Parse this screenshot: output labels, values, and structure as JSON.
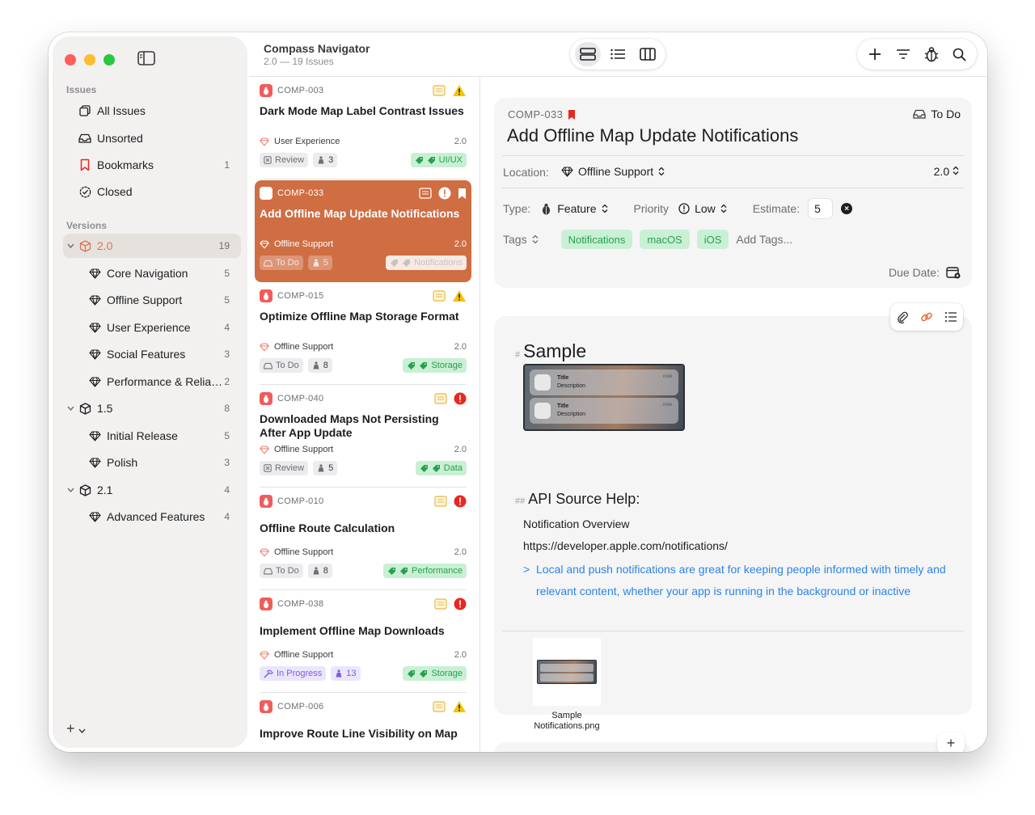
{
  "app": {
    "title": "Compass Navigator",
    "subtitle": "2.0 — 19 Issues"
  },
  "sidebar": {
    "issues_header": "Issues",
    "issues": [
      {
        "label": "All Issues",
        "icon": "stack-icon",
        "count": ""
      },
      {
        "label": "Unsorted",
        "icon": "tray-icon",
        "count": ""
      },
      {
        "label": "Bookmarks",
        "icon": "bookmark-icon",
        "count": "1"
      },
      {
        "label": "Closed",
        "icon": "check-seal-icon",
        "count": ""
      }
    ],
    "versions_header": "Versions",
    "versions": [
      {
        "label": "2.0",
        "count": "19",
        "selected": true,
        "children": [
          {
            "label": "Core Navigation",
            "count": "5"
          },
          {
            "label": "Offline Support",
            "count": "5"
          },
          {
            "label": "User Experience",
            "count": "4"
          },
          {
            "label": "Social Features",
            "count": "3"
          },
          {
            "label": "Performance & Relia…",
            "count": "2"
          }
        ]
      },
      {
        "label": "1.5",
        "count": "8",
        "children": [
          {
            "label": "Initial Release",
            "count": "5"
          },
          {
            "label": "Polish",
            "count": "3"
          }
        ]
      },
      {
        "label": "2.1",
        "count": "4",
        "children": [
          {
            "label": "Advanced Features",
            "count": "4"
          }
        ]
      }
    ]
  },
  "issues": [
    {
      "id": "COMP-003",
      "title": "Dark Mode Map Label Contrast Issues",
      "location": "User Experience",
      "version": "2.0",
      "status": "Review",
      "estimate": "3",
      "tag": "UI/UX",
      "priority": "warning"
    },
    {
      "id": "COMP-033",
      "title": "Add Offline Map Update Notifications",
      "location": "Offline Support",
      "version": "2.0",
      "status": "To Do",
      "estimate": "5",
      "tag": "Notifications",
      "priority": "exclaim",
      "selected": true
    },
    {
      "id": "COMP-015",
      "title": "Optimize Offline Map Storage Format",
      "location": "Offline Support",
      "version": "2.0",
      "status": "To Do",
      "estimate": "8",
      "tag": "Storage",
      "priority": "warning"
    },
    {
      "id": "COMP-040",
      "title": "Downloaded Maps Not Persisting After App Update",
      "location": "Offline Support",
      "version": "2.0",
      "status": "Review",
      "estimate": "5",
      "tag": "Data",
      "priority": "critical"
    },
    {
      "id": "COMP-010",
      "title": "Offline Route Calculation",
      "location": "Offline Support",
      "version": "2.0",
      "status": "To Do",
      "estimate": "8",
      "tag": "Performance",
      "priority": "critical"
    },
    {
      "id": "COMP-038",
      "title": "Implement Offline Map Downloads",
      "location": "Offline Support",
      "version": "2.0",
      "status": "In Progress",
      "estimate": "13",
      "tag": "Storage",
      "priority": "critical"
    },
    {
      "id": "COMP-006",
      "title": "Improve Route Line Visibility on Map",
      "location": "",
      "version": "",
      "status": "",
      "estimate": "",
      "tag": "",
      "priority": "warning"
    }
  ],
  "detail": {
    "id": "COMP-033",
    "status": "To Do",
    "title": "Add Offline Map Update Notifications",
    "location_label": "Location:",
    "location": "Offline Support",
    "version": "2.0",
    "type_label": "Type:",
    "type": "Feature",
    "priority_label": "Priority",
    "priority": "Low",
    "estimate_label": "Estimate:",
    "estimate": "5",
    "tags_label": "Tags",
    "tags": [
      "Notifications",
      "macOS",
      "iOS"
    ],
    "add_tags": "Add Tags...",
    "due_label": "Due Date:"
  },
  "notes": {
    "h1_mark": "#",
    "h1": "Sample",
    "image_alt": "Sample notifications preview",
    "notif_title": "Title",
    "notif_desc": "Description",
    "notif_time": "now",
    "h2_mark": "##",
    "h2": "API Source Help:",
    "line1": "Notification Overview",
    "line2": "https://developer.apple.com/notifications/",
    "quote_mark": ">",
    "quote": "Local and push notifications are great for keeping people informed with timely and relevant content, whether your app is running in the background or inactive",
    "attachment": "Sample Notifications.png"
  },
  "colors": {
    "accent": "#cf6d43",
    "tag_bg": "#c9f0d4",
    "tag_fg": "#27a04e",
    "bug": "#ef5d5a",
    "warning": "#f5c400",
    "critical": "#e8281f",
    "link": "#2a84e6"
  }
}
